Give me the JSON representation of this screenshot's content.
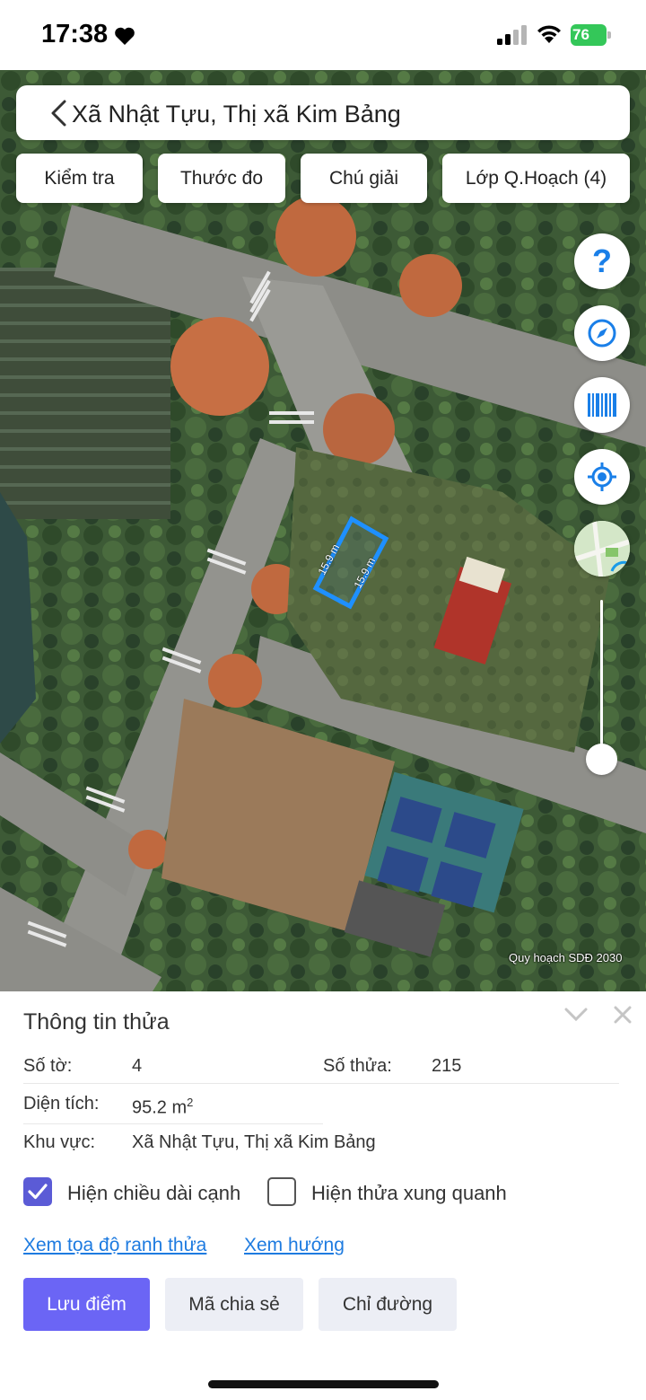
{
  "status_bar": {
    "time": "17:38",
    "battery": "76"
  },
  "header": {
    "title": "Xã Nhật Tựu, Thị xã Kim Bảng"
  },
  "toolbar": {
    "check": "Kiểm tra",
    "ruler": "Thước đo",
    "legend": "Chú giải",
    "layers": "Lớp Q.Hoạch (4)"
  },
  "map": {
    "credit": "Quy hoạch SDĐ 2030",
    "edge_label_1": "15.9 m",
    "edge_label_2": "15.9 m",
    "help_glyph": "?",
    "parcel_color": "#1e90ff",
    "zoom_level_fraction": 0.9
  },
  "panel": {
    "title": "Thông tin thửa",
    "sheet_label": "Số tờ:",
    "sheet_value": "4",
    "parcel_label": "Số thửa:",
    "parcel_value": "215",
    "area_label": "Diện tích:",
    "area_value": "95.2 m",
    "area_unit_sup": "2",
    "region_label": "Khu vực:",
    "region_value": "Xã Nhật Tựu, Thị xã Kim Bảng",
    "show_edge_length": {
      "label": "Hiện chiều dài cạnh",
      "checked": true
    },
    "show_neighbors": {
      "label": "Hiện thửa xung quanh",
      "checked": false
    },
    "link_coords": "Xem tọa độ ranh thửa",
    "link_direction": "Xem hướng",
    "btn_save": "Lưu điểm",
    "btn_share": "Mã chia sẻ",
    "btn_route": "Chỉ đường"
  },
  "colors": {
    "accent": "#6b65f5",
    "link": "#1e7be0",
    "battery": "#34c759"
  }
}
